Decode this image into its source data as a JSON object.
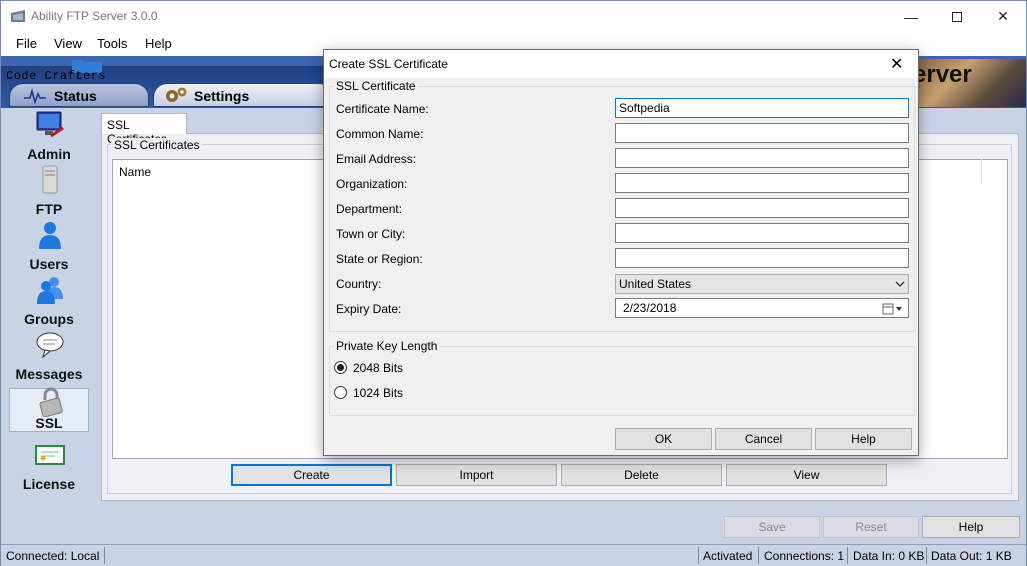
{
  "window": {
    "title": "Ability FTP Server 3.0.0"
  },
  "menu": [
    "File",
    "View",
    "Tools",
    "Help"
  ],
  "banner": {
    "brand": "Code Crafters",
    "word": "erver"
  },
  "tabs": {
    "status": "Status",
    "settings": "Settings"
  },
  "nav": [
    {
      "label": "Admin",
      "icon": "monitor-icon"
    },
    {
      "label": "FTP",
      "icon": "server-icon"
    },
    {
      "label": "Users",
      "icon": "user-icon"
    },
    {
      "label": "Groups",
      "icon": "group-icon"
    },
    {
      "label": "Messages",
      "icon": "speech-bubble-icon"
    },
    {
      "label": "SSL",
      "icon": "padlock-icon",
      "selected": true
    },
    {
      "label": "License",
      "icon": "certificate-icon"
    }
  ],
  "content": {
    "tab": "SSL Certificates",
    "group": "SSL Certificates",
    "column_name": "Name",
    "buttons": {
      "create": "Create",
      "import": "Import",
      "delete": "Delete",
      "view": "View"
    }
  },
  "footer_buttons": {
    "save": "Save",
    "reset": "Reset",
    "help": "Help"
  },
  "status": {
    "connected": "Connected: Local",
    "activated": "Activated",
    "connections": "Connections: 1",
    "data_in": "Data In: 0 KB",
    "data_out": "Data Out: 1 KB"
  },
  "dialog": {
    "title": "Create SSL Certificate",
    "group": "SSL Certificate",
    "fields": {
      "certificate_name": {
        "label": "Certificate Name:",
        "value": "Softpedia"
      },
      "common_name": {
        "label": "Common Name:",
        "value": ""
      },
      "email": {
        "label": "Email Address:",
        "value": ""
      },
      "organization": {
        "label": "Organization:",
        "value": ""
      },
      "department": {
        "label": "Department:",
        "value": ""
      },
      "town": {
        "label": "Town or City:",
        "value": ""
      },
      "state": {
        "label": "State or Region:",
        "value": ""
      },
      "country": {
        "label": "Country:",
        "value": "United States"
      },
      "expiry": {
        "label": "Expiry Date:",
        "value": "2/23/2018"
      }
    },
    "key_group": "Private Key Length",
    "key_options": {
      "opt2048": "2048 Bits",
      "opt1024": "1024 Bits",
      "selected": "2048 Bits"
    },
    "buttons": {
      "ok": "OK",
      "cancel": "Cancel",
      "help": "Help"
    }
  }
}
